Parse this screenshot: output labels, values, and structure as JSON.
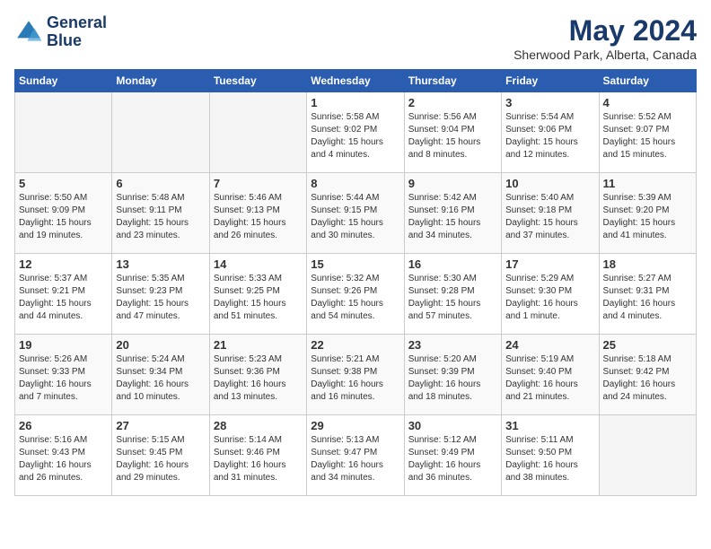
{
  "header": {
    "logo_line1": "General",
    "logo_line2": "Blue",
    "month_title": "May 2024",
    "location": "Sherwood Park, Alberta, Canada"
  },
  "weekdays": [
    "Sunday",
    "Monday",
    "Tuesday",
    "Wednesday",
    "Thursday",
    "Friday",
    "Saturday"
  ],
  "weeks": [
    [
      {
        "day": "",
        "empty": true
      },
      {
        "day": "",
        "empty": true
      },
      {
        "day": "",
        "empty": true
      },
      {
        "day": "1",
        "sunrise": "Sunrise: 5:58 AM",
        "sunset": "Sunset: 9:02 PM",
        "daylight": "Daylight: 15 hours and 4 minutes."
      },
      {
        "day": "2",
        "sunrise": "Sunrise: 5:56 AM",
        "sunset": "Sunset: 9:04 PM",
        "daylight": "Daylight: 15 hours and 8 minutes."
      },
      {
        "day": "3",
        "sunrise": "Sunrise: 5:54 AM",
        "sunset": "Sunset: 9:06 PM",
        "daylight": "Daylight: 15 hours and 12 minutes."
      },
      {
        "day": "4",
        "sunrise": "Sunrise: 5:52 AM",
        "sunset": "Sunset: 9:07 PM",
        "daylight": "Daylight: 15 hours and 15 minutes."
      }
    ],
    [
      {
        "day": "5",
        "sunrise": "Sunrise: 5:50 AM",
        "sunset": "Sunset: 9:09 PM",
        "daylight": "Daylight: 15 hours and 19 minutes."
      },
      {
        "day": "6",
        "sunrise": "Sunrise: 5:48 AM",
        "sunset": "Sunset: 9:11 PM",
        "daylight": "Daylight: 15 hours and 23 minutes."
      },
      {
        "day": "7",
        "sunrise": "Sunrise: 5:46 AM",
        "sunset": "Sunset: 9:13 PM",
        "daylight": "Daylight: 15 hours and 26 minutes."
      },
      {
        "day": "8",
        "sunrise": "Sunrise: 5:44 AM",
        "sunset": "Sunset: 9:15 PM",
        "daylight": "Daylight: 15 hours and 30 minutes."
      },
      {
        "day": "9",
        "sunrise": "Sunrise: 5:42 AM",
        "sunset": "Sunset: 9:16 PM",
        "daylight": "Daylight: 15 hours and 34 minutes."
      },
      {
        "day": "10",
        "sunrise": "Sunrise: 5:40 AM",
        "sunset": "Sunset: 9:18 PM",
        "daylight": "Daylight: 15 hours and 37 minutes."
      },
      {
        "day": "11",
        "sunrise": "Sunrise: 5:39 AM",
        "sunset": "Sunset: 9:20 PM",
        "daylight": "Daylight: 15 hours and 41 minutes."
      }
    ],
    [
      {
        "day": "12",
        "sunrise": "Sunrise: 5:37 AM",
        "sunset": "Sunset: 9:21 PM",
        "daylight": "Daylight: 15 hours and 44 minutes."
      },
      {
        "day": "13",
        "sunrise": "Sunrise: 5:35 AM",
        "sunset": "Sunset: 9:23 PM",
        "daylight": "Daylight: 15 hours and 47 minutes."
      },
      {
        "day": "14",
        "sunrise": "Sunrise: 5:33 AM",
        "sunset": "Sunset: 9:25 PM",
        "daylight": "Daylight: 15 hours and 51 minutes."
      },
      {
        "day": "15",
        "sunrise": "Sunrise: 5:32 AM",
        "sunset": "Sunset: 9:26 PM",
        "daylight": "Daylight: 15 hours and 54 minutes."
      },
      {
        "day": "16",
        "sunrise": "Sunrise: 5:30 AM",
        "sunset": "Sunset: 9:28 PM",
        "daylight": "Daylight: 15 hours and 57 minutes."
      },
      {
        "day": "17",
        "sunrise": "Sunrise: 5:29 AM",
        "sunset": "Sunset: 9:30 PM",
        "daylight": "Daylight: 16 hours and 1 minute."
      },
      {
        "day": "18",
        "sunrise": "Sunrise: 5:27 AM",
        "sunset": "Sunset: 9:31 PM",
        "daylight": "Daylight: 16 hours and 4 minutes."
      }
    ],
    [
      {
        "day": "19",
        "sunrise": "Sunrise: 5:26 AM",
        "sunset": "Sunset: 9:33 PM",
        "daylight": "Daylight: 16 hours and 7 minutes."
      },
      {
        "day": "20",
        "sunrise": "Sunrise: 5:24 AM",
        "sunset": "Sunset: 9:34 PM",
        "daylight": "Daylight: 16 hours and 10 minutes."
      },
      {
        "day": "21",
        "sunrise": "Sunrise: 5:23 AM",
        "sunset": "Sunset: 9:36 PM",
        "daylight": "Daylight: 16 hours and 13 minutes."
      },
      {
        "day": "22",
        "sunrise": "Sunrise: 5:21 AM",
        "sunset": "Sunset: 9:38 PM",
        "daylight": "Daylight: 16 hours and 16 minutes."
      },
      {
        "day": "23",
        "sunrise": "Sunrise: 5:20 AM",
        "sunset": "Sunset: 9:39 PM",
        "daylight": "Daylight: 16 hours and 18 minutes."
      },
      {
        "day": "24",
        "sunrise": "Sunrise: 5:19 AM",
        "sunset": "Sunset: 9:40 PM",
        "daylight": "Daylight: 16 hours and 21 minutes."
      },
      {
        "day": "25",
        "sunrise": "Sunrise: 5:18 AM",
        "sunset": "Sunset: 9:42 PM",
        "daylight": "Daylight: 16 hours and 24 minutes."
      }
    ],
    [
      {
        "day": "26",
        "sunrise": "Sunrise: 5:16 AM",
        "sunset": "Sunset: 9:43 PM",
        "daylight": "Daylight: 16 hours and 26 minutes."
      },
      {
        "day": "27",
        "sunrise": "Sunrise: 5:15 AM",
        "sunset": "Sunset: 9:45 PM",
        "daylight": "Daylight: 16 hours and 29 minutes."
      },
      {
        "day": "28",
        "sunrise": "Sunrise: 5:14 AM",
        "sunset": "Sunset: 9:46 PM",
        "daylight": "Daylight: 16 hours and 31 minutes."
      },
      {
        "day": "29",
        "sunrise": "Sunrise: 5:13 AM",
        "sunset": "Sunset: 9:47 PM",
        "daylight": "Daylight: 16 hours and 34 minutes."
      },
      {
        "day": "30",
        "sunrise": "Sunrise: 5:12 AM",
        "sunset": "Sunset: 9:49 PM",
        "daylight": "Daylight: 16 hours and 36 minutes."
      },
      {
        "day": "31",
        "sunrise": "Sunrise: 5:11 AM",
        "sunset": "Sunset: 9:50 PM",
        "daylight": "Daylight: 16 hours and 38 minutes."
      },
      {
        "day": "",
        "empty": true
      }
    ]
  ]
}
